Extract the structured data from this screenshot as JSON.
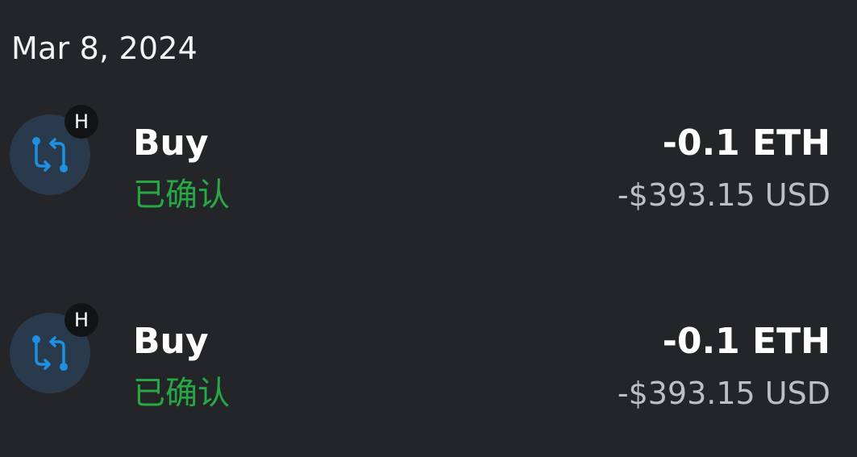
{
  "date_header": "Mar 8, 2024",
  "colors": {
    "background": "#232529",
    "status_confirmed": "#28a745",
    "icon_accent": "#1e8fe1",
    "icon_bg": "#2a3a4d",
    "secondary_text": "#bbc0c5"
  },
  "transactions": [
    {
      "icon": "swap-arrows-icon",
      "network_badge": "H",
      "type": "Buy",
      "status": "已确认",
      "amount": "-0.1 ETH",
      "fiat_amount": "-$393.15 USD"
    },
    {
      "icon": "swap-arrows-icon",
      "network_badge": "H",
      "type": "Buy",
      "status": "已确认",
      "amount": "-0.1 ETH",
      "fiat_amount": "-$393.15 USD"
    }
  ]
}
